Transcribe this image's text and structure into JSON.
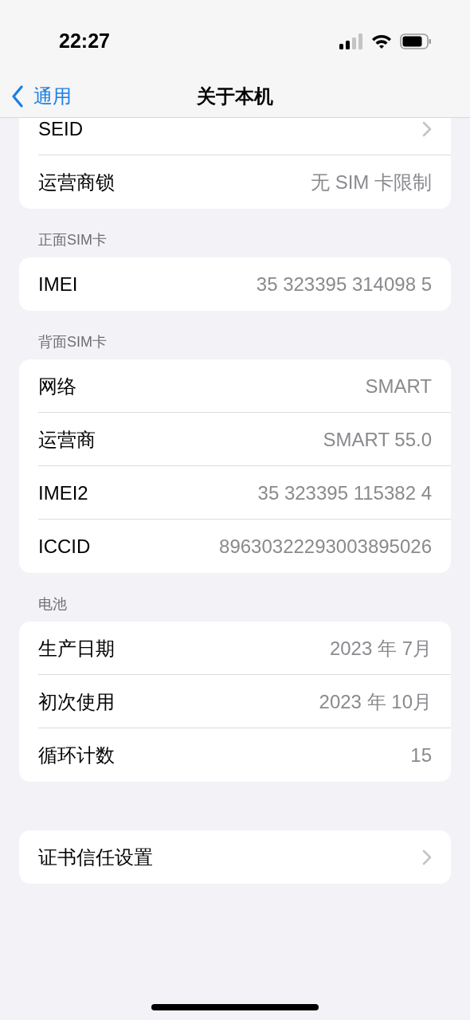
{
  "status_bar": {
    "time": "22:27"
  },
  "nav": {
    "back": "通用",
    "title": "关于本机"
  },
  "sections": [
    {
      "rows": [
        {
          "kind": "link",
          "label": "SEID"
        },
        {
          "kind": "info",
          "label": "运营商锁",
          "value": "无 SIM 卡限制"
        }
      ]
    },
    {
      "header": "正面SIM卡",
      "rows": [
        {
          "kind": "info",
          "label": "IMEI",
          "value": "35 323395 314098 5"
        }
      ]
    },
    {
      "header": "背面SIM卡",
      "rows": [
        {
          "kind": "info",
          "label": "网络",
          "value": "SMART"
        },
        {
          "kind": "info",
          "label": "运营商",
          "value": "SMART 55.0"
        },
        {
          "kind": "info",
          "label": "IMEI2",
          "value": "35 323395 115382 4"
        },
        {
          "kind": "info",
          "label": "ICCID",
          "value": "89630322293003895026"
        }
      ]
    },
    {
      "header": "电池",
      "rows": [
        {
          "kind": "info",
          "label": "生产日期",
          "value": "2023 年 7月"
        },
        {
          "kind": "info",
          "label": "初次使用",
          "value": "2023 年 10月"
        },
        {
          "kind": "info",
          "label": "循环计数",
          "value": "15"
        }
      ]
    },
    {
      "rows": [
        {
          "kind": "link",
          "label": "证书信任设置"
        }
      ]
    }
  ]
}
